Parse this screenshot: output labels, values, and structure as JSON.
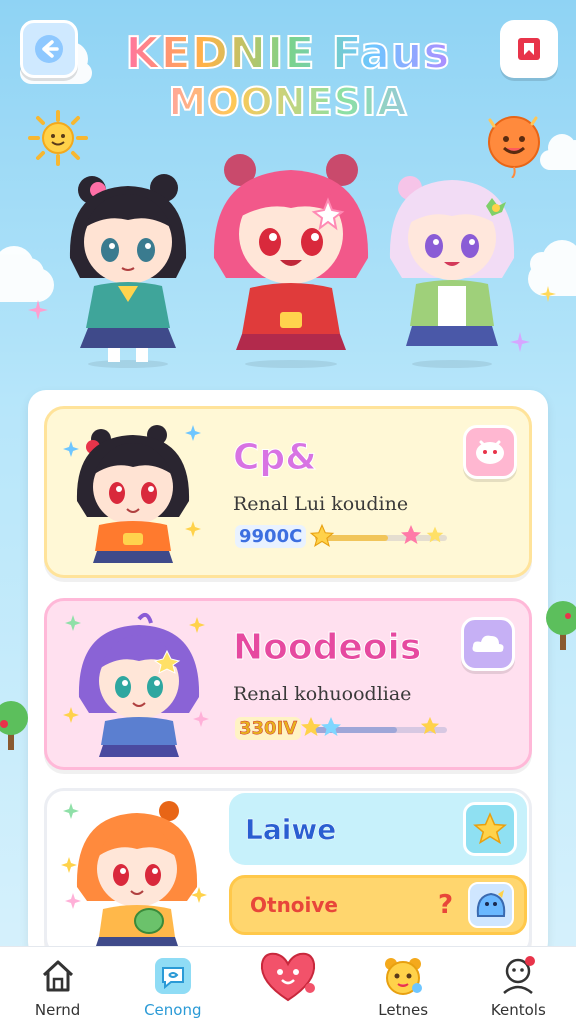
{
  "header": {
    "title_line1": "KEDNIE Faus",
    "title_line2": "MOONESIA",
    "back_icon": "arrow-left-icon",
    "bookmark_icon": "bookmark-icon"
  },
  "cards": [
    {
      "name": "Cp&",
      "subtitle": "Renal Lui koudine",
      "score": "9900C",
      "progress": 0.55,
      "action_icon": "face-icon",
      "accent": "#d873e3"
    },
    {
      "name": "Noodeois",
      "subtitle": "Renal kohuoodliae",
      "score": "330IV",
      "progress": 0.62,
      "action_icon": "cloud-icon",
      "accent": "#e64aa0"
    },
    {
      "latest_label": "Laiwe",
      "latest_icon": "star-icon",
      "notice_label": "Otnoive",
      "notice_mark": "?",
      "notice_icon": "ghost-icon"
    }
  ],
  "nav": [
    {
      "label": "Nernd",
      "icon": "home-icon",
      "active": false
    },
    {
      "label": "Cenong",
      "icon": "chat-icon",
      "active": true
    },
    {
      "label": "",
      "icon": "heart-character-icon",
      "active": false
    },
    {
      "label": "Letnes",
      "icon": "bear-character-icon",
      "active": false
    },
    {
      "label": "Kentols",
      "icon": "profile-icon",
      "active": false
    }
  ],
  "colors": {
    "sky_top": "#8fd3f4",
    "active_nav": "#2a9ad6"
  }
}
